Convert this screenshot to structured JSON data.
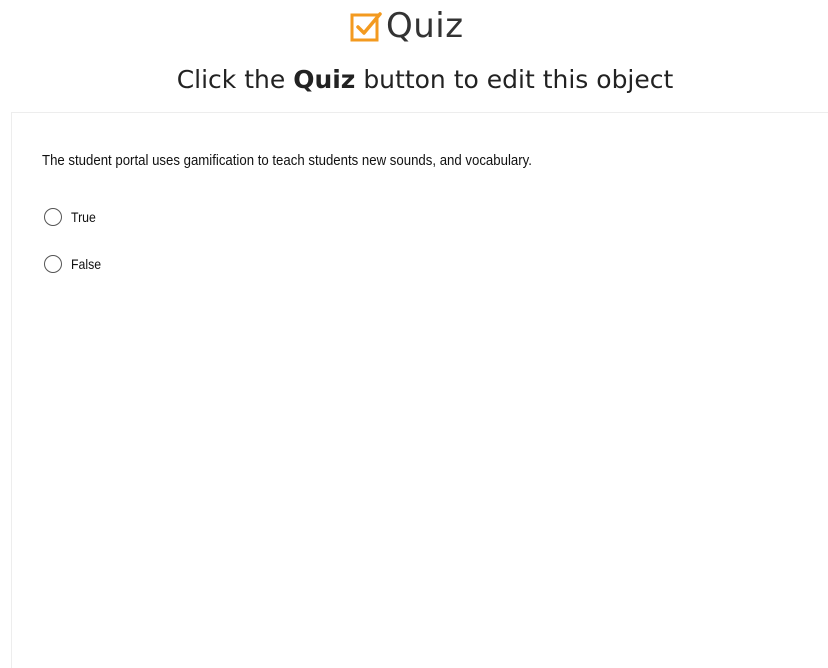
{
  "header": {
    "title": "Quiz",
    "icon": "checkbox-check-icon",
    "icon_color": "#f39a1f",
    "instruction_prefix": "Click the",
    "instruction_bold": "Quiz",
    "instruction_suffix": "button to edit this object"
  },
  "quiz": {
    "question": "The student portal uses gamification to teach students new sounds, and vocabulary.",
    "options": [
      {
        "label": "True",
        "selected": false
      },
      {
        "label": "False",
        "selected": false
      }
    ]
  }
}
